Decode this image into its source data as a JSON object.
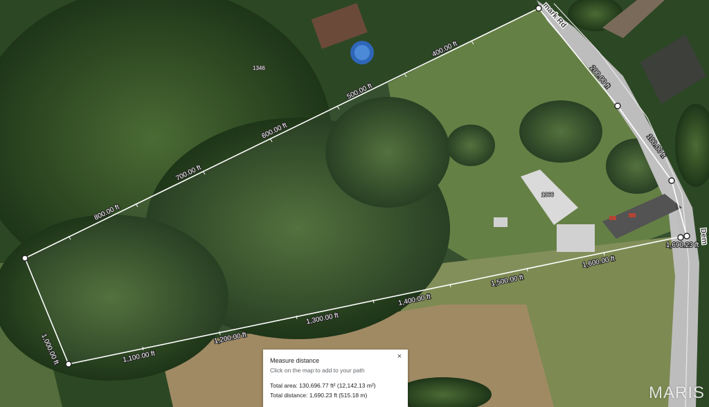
{
  "map": {
    "road_labels": [
      "mark Rd",
      "Dem"
    ],
    "parcel_labels": [
      "1346",
      "1366"
    ],
    "segment_labels": [
      "200.00 ft",
      "100.00 ft",
      "1,690.23 ft",
      "1,600.00 ft",
      "1,500.00 ft",
      "1,400.00 ft",
      "1,300.00 ft",
      "1,200.00 ft",
      "1,100.00 ft",
      "1,000.00 ft",
      "800.00 ft",
      "700.00 ft",
      "600.00 ft",
      "500.00 ft",
      "400.00 ft"
    ]
  },
  "measure_panel": {
    "title": "Measure distance",
    "hint": "Click on the map to add to your path",
    "total_area": "Total area: 130,696.77 ft² (12,142.13 m²)",
    "total_distance": "Total distance: 1,690.23 ft (515.18 m)",
    "close_icon": "×"
  },
  "watermark": "MARIS",
  "colors": {
    "path": "#ffffff",
    "vertex_fill": "#ffffff",
    "vertex_stroke": "#222222",
    "road": "#bdbdbd"
  }
}
